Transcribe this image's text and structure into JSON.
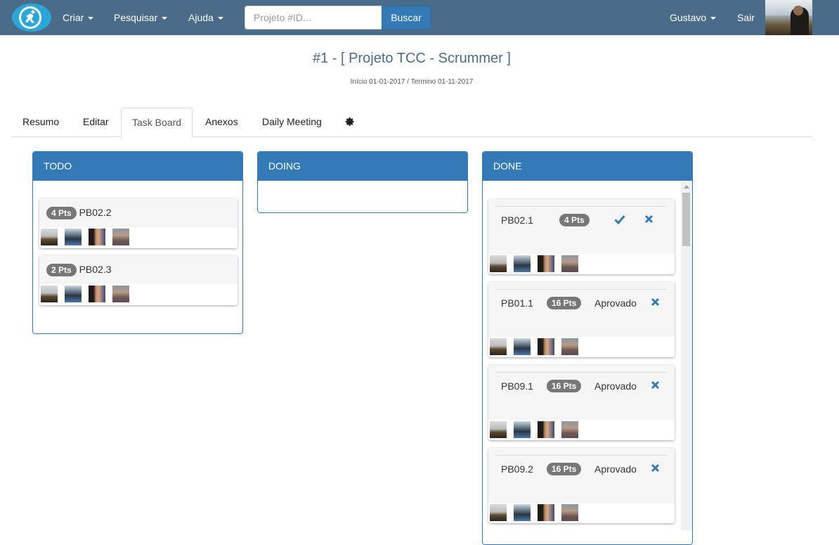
{
  "navbar": {
    "menu": [
      {
        "label": "Criar"
      },
      {
        "label": "Pesquisar"
      },
      {
        "label": "Ajuda"
      }
    ],
    "search_placeholder": "Projeto #ID...",
    "search_button": "Buscar",
    "user": "Gustavo",
    "logout": "Sair"
  },
  "project": {
    "title": "#1 - [ Projeto TCC - Scrummer ]",
    "dates": "Início 01-01-2017 / Termino 01-11-2017"
  },
  "tabs": [
    {
      "label": "Resumo"
    },
    {
      "label": "Editar"
    },
    {
      "label": "Task Board",
      "active": true
    },
    {
      "label": "Anexos"
    },
    {
      "label": "Daily Meeting"
    }
  ],
  "board": {
    "todo": {
      "title": "TODO",
      "cards": [
        {
          "points": "4 Pts",
          "code": "PB02.2"
        },
        {
          "points": "2 Pts",
          "code": "PB02.3"
        }
      ]
    },
    "doing": {
      "title": "DOING",
      "cards": []
    },
    "done": {
      "title": "DONE",
      "cards": [
        {
          "code": "PB02.1",
          "points": "4 Pts",
          "status": ""
        },
        {
          "code": "PB01.1",
          "points": "16 Pts",
          "status": "Aprovado"
        },
        {
          "code": "PB09.1",
          "points": "16 Pts",
          "status": "Aprovado"
        },
        {
          "code": "PB09.2",
          "points": "16 Pts",
          "status": "Aprovado"
        }
      ]
    }
  },
  "colors": {
    "navbar": "#4a6c89",
    "primary": "#337ab7",
    "badge": "#777777"
  },
  "icons": [
    "logo-icon",
    "caret-down-icon",
    "gear-icon",
    "check-icon",
    "close-icon"
  ]
}
